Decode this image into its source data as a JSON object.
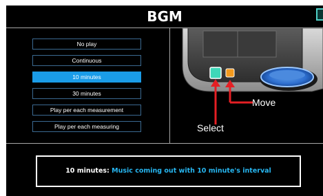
{
  "header": {
    "title": "BGM"
  },
  "options": [
    {
      "label": "No play",
      "selected": false
    },
    {
      "label": "Continuous",
      "selected": false
    },
    {
      "label": "10 minutes",
      "selected": true
    },
    {
      "label": "30 minutes",
      "selected": false
    },
    {
      "label": "Play per each measurement",
      "selected": false
    },
    {
      "label": "Play per each measuring",
      "selected": false
    }
  ],
  "illustration": {
    "select_label": "Select",
    "move_label": "Move",
    "select_button_color": "#3fd7b8",
    "move_button_color": "#f39a1e",
    "arrow_color": "#e51f24"
  },
  "info": {
    "key": "10 minutes:",
    "description": "Music coming out with 10 minute's interval"
  },
  "colors": {
    "selected_bg": "#1a9ce8",
    "option_border": "#3b6a92",
    "description_text": "#27b6f0"
  }
}
